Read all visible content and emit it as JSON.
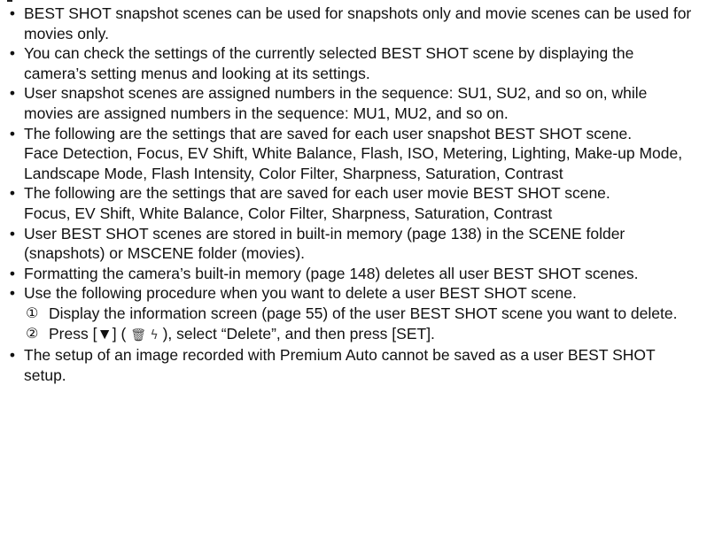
{
  "bullets": [
    {
      "text": "BEST SHOT snapshot scenes can be used for snapshots only and movie scenes can be used for movies only."
    },
    {
      "text": "You can check the settings of the currently selected BEST SHOT scene by displaying the camera’s setting menus and looking at its settings."
    },
    {
      "text": "User snapshot scenes are assigned numbers in the sequence: SU1, SU2, and so on, while movies are assigned numbers in the sequence: MU1, MU2, and so on."
    },
    {
      "text": "The following are the settings that are saved for each user snapshot BEST SHOT scene.",
      "extra": "Face Detection, Focus, EV Shift, White Balance, Flash, ISO, Metering, Lighting, Make-up Mode, Landscape Mode, Flash Intensity, Color Filter, Sharpness, Saturation, Contrast"
    },
    {
      "text": "The following are the settings that are saved for each user movie BEST SHOT scene.",
      "extra": "Focus, EV Shift, White Balance, Color Filter, Sharpness, Saturation, Contrast"
    },
    {
      "text": "User BEST SHOT scenes are stored in built-in memory (page 138) in the SCENE folder (snapshots) or MSCENE folder (movies)."
    },
    {
      "text": "Formatting the camera’s built-in memory (page 148) deletes all user BEST SHOT scenes."
    },
    {
      "text": "Use the following procedure when you want to delete a user BEST SHOT scene.",
      "steps": [
        {
          "num": "①",
          "text": "Display the information screen (page 55) of the user BEST SHOT scene you want to delete."
        },
        {
          "num": "②",
          "text_before": "Press [▼] (",
          "icons": "🗑 ϟ",
          "text_after": "), select “Delete”, and then press [SET]."
        }
      ]
    },
    {
      "text": "The setup of an image recorded with Premium Auto cannot be saved as a user BEST SHOT setup."
    }
  ],
  "bullet_glyph": "•"
}
